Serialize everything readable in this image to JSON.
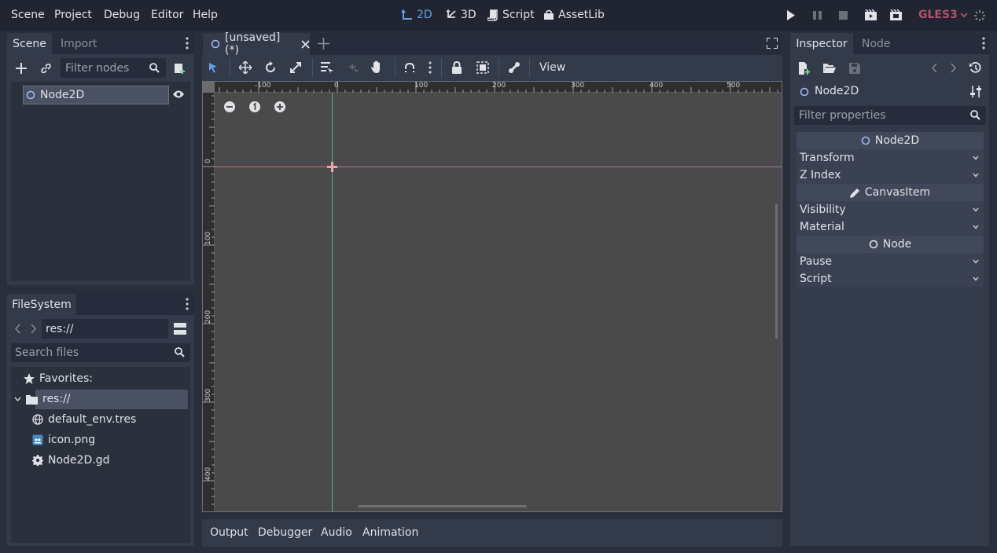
{
  "menu": [
    "Scene",
    "Project",
    "Debug",
    "Editor",
    "Help"
  ],
  "workspaces": {
    "w2d": "2D",
    "w3d": "3D",
    "script": "Script",
    "assetlib": "AssetLib"
  },
  "renderer": "GLES3",
  "colors": {
    "accent": "#699ce8",
    "renderer": "#b5526a",
    "bg": "#333a4a",
    "viewport": "#4a4a4a"
  },
  "scene_dock": {
    "tabs": [
      "Scene",
      "Import"
    ],
    "filter_placeholder": "Filter nodes",
    "root_node": "Node2D"
  },
  "filesystem": {
    "title": "FileSystem",
    "path": "res://",
    "search_placeholder": "Search files",
    "favorites": "Favorites:",
    "root": "res://",
    "files": [
      {
        "name": "default_env.tres",
        "icon": "globe-icon"
      },
      {
        "name": "icon.png",
        "icon": "image-icon"
      },
      {
        "name": "Node2D.gd",
        "icon": "gear-icon"
      }
    ]
  },
  "editor": {
    "tab_title": "[unsaved](*)",
    "view_menu": "View",
    "ruler_x": [
      "-100",
      "0",
      "100",
      "200",
      "300",
      "400",
      "500"
    ],
    "ruler_y": [
      "0",
      "100",
      "200",
      "300",
      "400"
    ]
  },
  "bottom_tabs": [
    "Output",
    "Debugger",
    "Audio",
    "Animation"
  ],
  "inspector": {
    "tabs": [
      "Inspector",
      "Node"
    ],
    "node_name": "Node2D",
    "filter_placeholder": "Filter properties",
    "sections": {
      "node2d": "Node2D",
      "transform": "Transform",
      "zindex": "Z Index",
      "canvasitem": "CanvasItem",
      "visibility": "Visibility",
      "material": "Material",
      "node": "Node",
      "pause": "Pause",
      "script": "Script"
    }
  }
}
